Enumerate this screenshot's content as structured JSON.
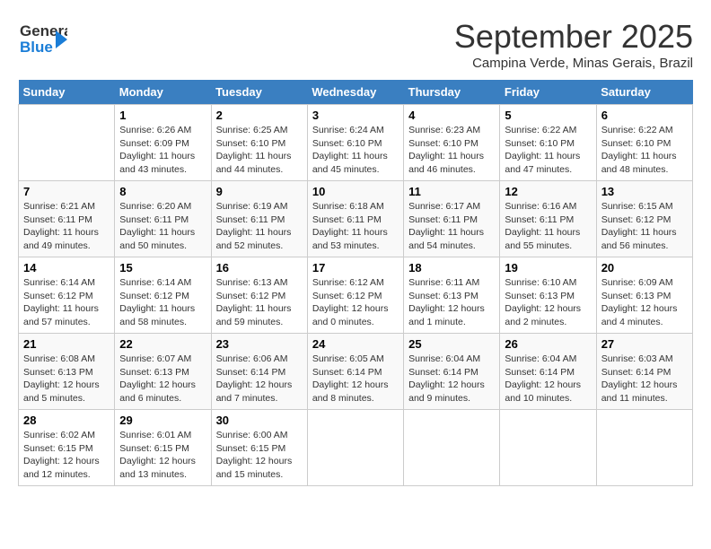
{
  "header": {
    "logo_general": "General",
    "logo_blue": "Blue",
    "title": "September 2025",
    "location": "Campina Verde, Minas Gerais, Brazil"
  },
  "weekdays": [
    "Sunday",
    "Monday",
    "Tuesday",
    "Wednesday",
    "Thursday",
    "Friday",
    "Saturday"
  ],
  "weeks": [
    [
      {
        "day": "",
        "info": ""
      },
      {
        "day": "1",
        "info": "Sunrise: 6:26 AM\nSunset: 6:09 PM\nDaylight: 11 hours\nand 43 minutes."
      },
      {
        "day": "2",
        "info": "Sunrise: 6:25 AM\nSunset: 6:10 PM\nDaylight: 11 hours\nand 44 minutes."
      },
      {
        "day": "3",
        "info": "Sunrise: 6:24 AM\nSunset: 6:10 PM\nDaylight: 11 hours\nand 45 minutes."
      },
      {
        "day": "4",
        "info": "Sunrise: 6:23 AM\nSunset: 6:10 PM\nDaylight: 11 hours\nand 46 minutes."
      },
      {
        "day": "5",
        "info": "Sunrise: 6:22 AM\nSunset: 6:10 PM\nDaylight: 11 hours\nand 47 minutes."
      },
      {
        "day": "6",
        "info": "Sunrise: 6:22 AM\nSunset: 6:10 PM\nDaylight: 11 hours\nand 48 minutes."
      }
    ],
    [
      {
        "day": "7",
        "info": "Sunrise: 6:21 AM\nSunset: 6:11 PM\nDaylight: 11 hours\nand 49 minutes."
      },
      {
        "day": "8",
        "info": "Sunrise: 6:20 AM\nSunset: 6:11 PM\nDaylight: 11 hours\nand 50 minutes."
      },
      {
        "day": "9",
        "info": "Sunrise: 6:19 AM\nSunset: 6:11 PM\nDaylight: 11 hours\nand 52 minutes."
      },
      {
        "day": "10",
        "info": "Sunrise: 6:18 AM\nSunset: 6:11 PM\nDaylight: 11 hours\nand 53 minutes."
      },
      {
        "day": "11",
        "info": "Sunrise: 6:17 AM\nSunset: 6:11 PM\nDaylight: 11 hours\nand 54 minutes."
      },
      {
        "day": "12",
        "info": "Sunrise: 6:16 AM\nSunset: 6:11 PM\nDaylight: 11 hours\nand 55 minutes."
      },
      {
        "day": "13",
        "info": "Sunrise: 6:15 AM\nSunset: 6:12 PM\nDaylight: 11 hours\nand 56 minutes."
      }
    ],
    [
      {
        "day": "14",
        "info": "Sunrise: 6:14 AM\nSunset: 6:12 PM\nDaylight: 11 hours\nand 57 minutes."
      },
      {
        "day": "15",
        "info": "Sunrise: 6:14 AM\nSunset: 6:12 PM\nDaylight: 11 hours\nand 58 minutes."
      },
      {
        "day": "16",
        "info": "Sunrise: 6:13 AM\nSunset: 6:12 PM\nDaylight: 11 hours\nand 59 minutes."
      },
      {
        "day": "17",
        "info": "Sunrise: 6:12 AM\nSunset: 6:12 PM\nDaylight: 12 hours\nand 0 minutes."
      },
      {
        "day": "18",
        "info": "Sunrise: 6:11 AM\nSunset: 6:13 PM\nDaylight: 12 hours\nand 1 minute."
      },
      {
        "day": "19",
        "info": "Sunrise: 6:10 AM\nSunset: 6:13 PM\nDaylight: 12 hours\nand 2 minutes."
      },
      {
        "day": "20",
        "info": "Sunrise: 6:09 AM\nSunset: 6:13 PM\nDaylight: 12 hours\nand 4 minutes."
      }
    ],
    [
      {
        "day": "21",
        "info": "Sunrise: 6:08 AM\nSunset: 6:13 PM\nDaylight: 12 hours\nand 5 minutes."
      },
      {
        "day": "22",
        "info": "Sunrise: 6:07 AM\nSunset: 6:13 PM\nDaylight: 12 hours\nand 6 minutes."
      },
      {
        "day": "23",
        "info": "Sunrise: 6:06 AM\nSunset: 6:14 PM\nDaylight: 12 hours\nand 7 minutes."
      },
      {
        "day": "24",
        "info": "Sunrise: 6:05 AM\nSunset: 6:14 PM\nDaylight: 12 hours\nand 8 minutes."
      },
      {
        "day": "25",
        "info": "Sunrise: 6:04 AM\nSunset: 6:14 PM\nDaylight: 12 hours\nand 9 minutes."
      },
      {
        "day": "26",
        "info": "Sunrise: 6:04 AM\nSunset: 6:14 PM\nDaylight: 12 hours\nand 10 minutes."
      },
      {
        "day": "27",
        "info": "Sunrise: 6:03 AM\nSunset: 6:14 PM\nDaylight: 12 hours\nand 11 minutes."
      }
    ],
    [
      {
        "day": "28",
        "info": "Sunrise: 6:02 AM\nSunset: 6:15 PM\nDaylight: 12 hours\nand 12 minutes."
      },
      {
        "day": "29",
        "info": "Sunrise: 6:01 AM\nSunset: 6:15 PM\nDaylight: 12 hours\nand 13 minutes."
      },
      {
        "day": "30",
        "info": "Sunrise: 6:00 AM\nSunset: 6:15 PM\nDaylight: 12 hours\nand 15 minutes."
      },
      {
        "day": "",
        "info": ""
      },
      {
        "day": "",
        "info": ""
      },
      {
        "day": "",
        "info": ""
      },
      {
        "day": "",
        "info": ""
      }
    ]
  ]
}
